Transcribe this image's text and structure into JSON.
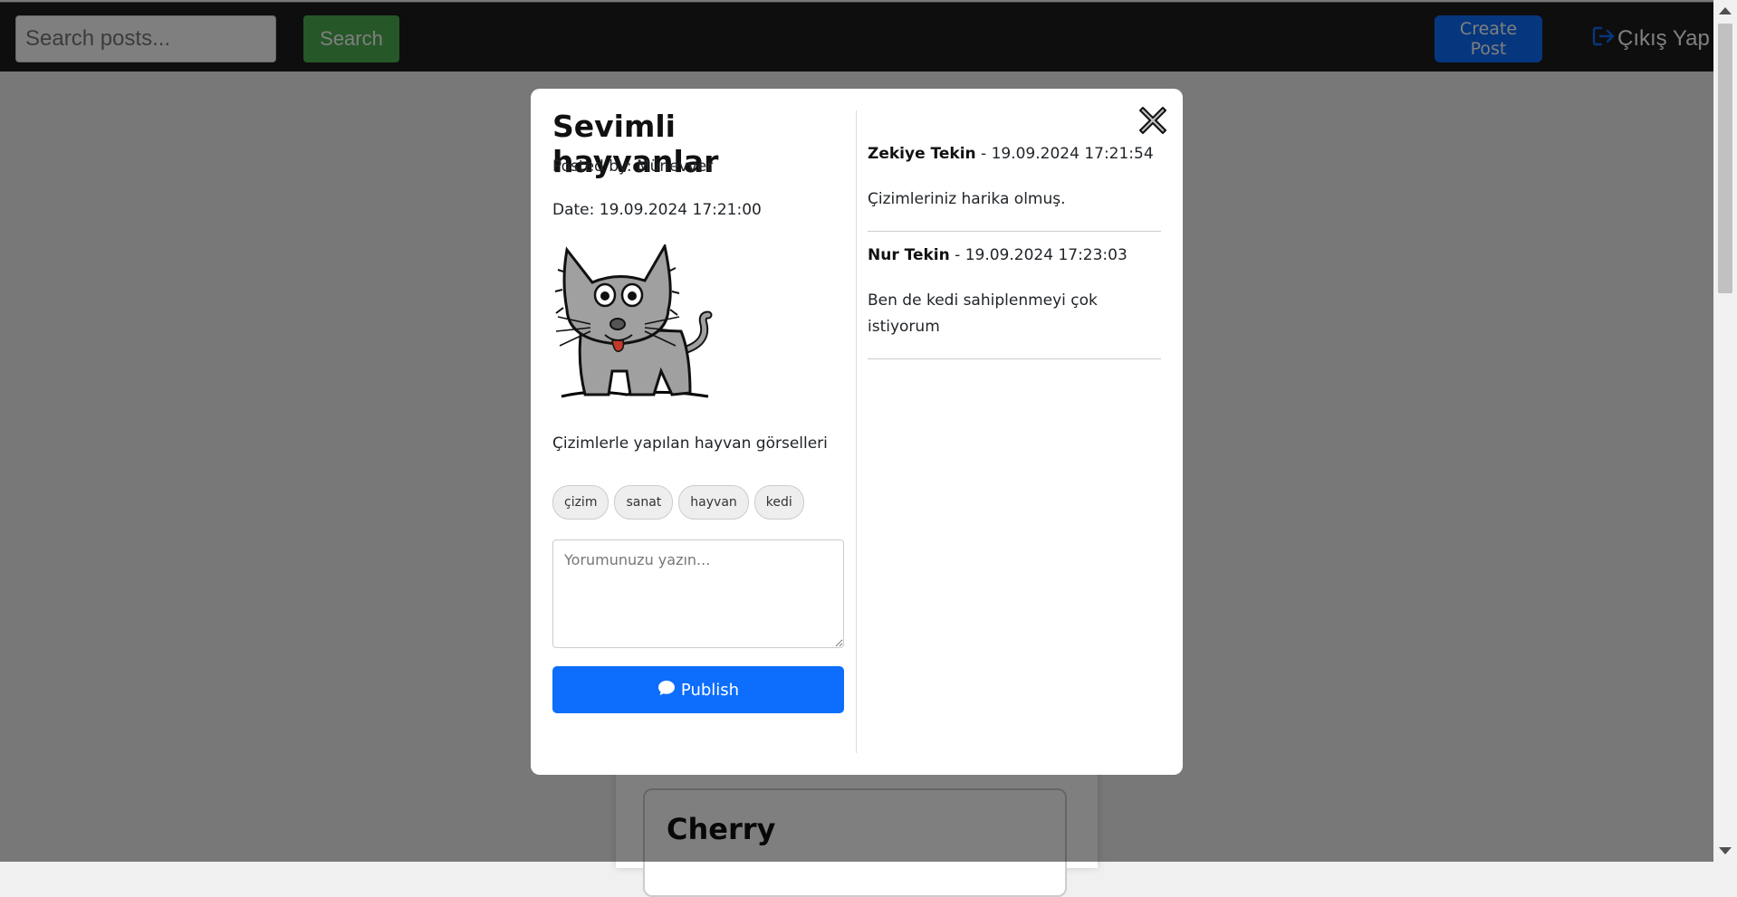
{
  "navbar": {
    "search_placeholder": "Search posts...",
    "search_label": "Search",
    "create_post_label": "Create Post",
    "logout_label": "Çıkış Yap"
  },
  "feed": {
    "visible_post_title": "Cherry"
  },
  "modal": {
    "title": "Sevimli hayvanlar",
    "posted_by": "Posted by: Münevver",
    "date": "Date: 19.09.2024 17:21:00",
    "description": "Çizimlerle yapılan hayvan görselleri",
    "tags": [
      "çizim",
      "sanat",
      "hayvan",
      "kedi"
    ],
    "comment_placeholder": "Yorumunuzu yazın...",
    "publish_label": "Publish",
    "comments": [
      {
        "author": "Zekiye Tekin",
        "separator": " - ",
        "timestamp": "19.09.2024 17:21:54",
        "text": "Çizimleriniz harika olmuş."
      },
      {
        "author": "Nur Tekin",
        "separator": " - ",
        "timestamp": "19.09.2024 17:23:03",
        "text": "Ben de kedi sahiplenmeyi çok istiyorum"
      }
    ]
  },
  "colors": {
    "navbar_bg": "#1c1c1c",
    "search_button": "#4caf50",
    "primary": "#0d6efd",
    "overlay": "rgba(0,0,0,0.5)"
  },
  "icons": {
    "logout": "logout-icon",
    "close": "close-icon",
    "publish": "comment-icon"
  }
}
